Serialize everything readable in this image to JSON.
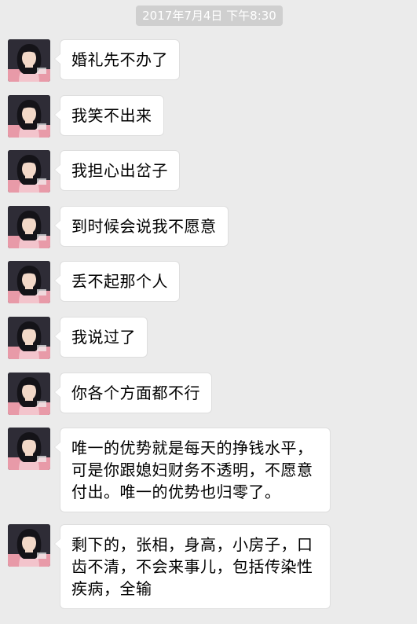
{
  "chat": {
    "timestamp": "2017年7月4日 下午8:30",
    "messages": [
      {
        "text": "婚礼先不办了"
      },
      {
        "text": "我笑不出来"
      },
      {
        "text": "我担心出岔子"
      },
      {
        "text": "到时候会说我不愿意"
      },
      {
        "text": "丢不起那个人"
      },
      {
        "text": "我说过了"
      },
      {
        "text": "你各个方面都不行"
      },
      {
        "text": "唯一的优势就是每天的挣钱水平，可是你跟媳妇财务不透明，不愿意付出。唯一的优势也归零了。"
      },
      {
        "text": "剩下的，张相，身高，小房子，口齿不清，不会来事儿，包括传染性疾病，全输"
      }
    ]
  }
}
